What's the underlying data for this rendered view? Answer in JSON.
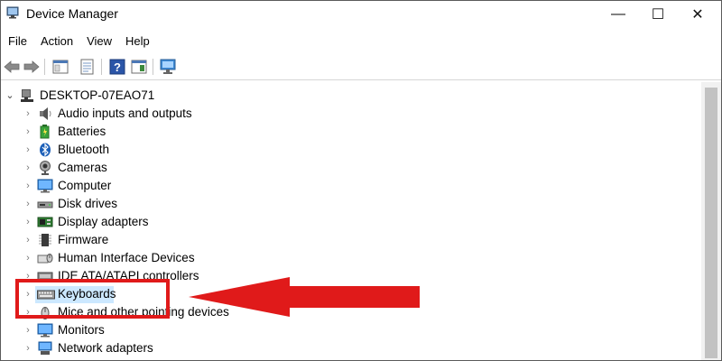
{
  "window": {
    "title": "Device Manager",
    "minimize_glyph": "—",
    "maximize_glyph": "☐",
    "close_glyph": "✕"
  },
  "menu": [
    "File",
    "Action",
    "View",
    "Help"
  ],
  "toolbar": {
    "icons": [
      "back-arrow-icon",
      "forward-arrow-icon",
      "show-hide-console-tree-icon",
      "properties-icon",
      "help-icon",
      "action-pane-icon",
      "scan-hardware-icon"
    ]
  },
  "tree": {
    "root": {
      "label": "DESKTOP-07EAO71",
      "icon": "computer-root-icon",
      "expanded": true
    },
    "items": [
      {
        "label": "Audio inputs and outputs",
        "icon": "speaker-icon"
      },
      {
        "label": "Batteries",
        "icon": "battery-icon"
      },
      {
        "label": "Bluetooth",
        "icon": "bluetooth-icon"
      },
      {
        "label": "Cameras",
        "icon": "camera-icon"
      },
      {
        "label": "Computer",
        "icon": "monitor-icon"
      },
      {
        "label": "Disk drives",
        "icon": "disk-drive-icon"
      },
      {
        "label": "Display adapters",
        "icon": "display-adapter-icon"
      },
      {
        "label": "Firmware",
        "icon": "firmware-icon"
      },
      {
        "label": "Human Interface Devices",
        "icon": "hid-icon"
      },
      {
        "label": "IDE ATA/ATAPI controllers",
        "icon": "ide-controller-icon"
      },
      {
        "label": "Keyboards",
        "icon": "keyboard-icon",
        "selected": true
      },
      {
        "label": "Mice and other pointing devices",
        "icon": "mouse-icon"
      },
      {
        "label": "Monitors",
        "icon": "monitor-icon"
      },
      {
        "label": "Network adapters",
        "icon": "network-adapter-icon"
      }
    ]
  },
  "colors": {
    "highlight_border": "#e01a1a",
    "arrow_fill": "#e01a1a",
    "selection_bg": "#cce8ff"
  }
}
